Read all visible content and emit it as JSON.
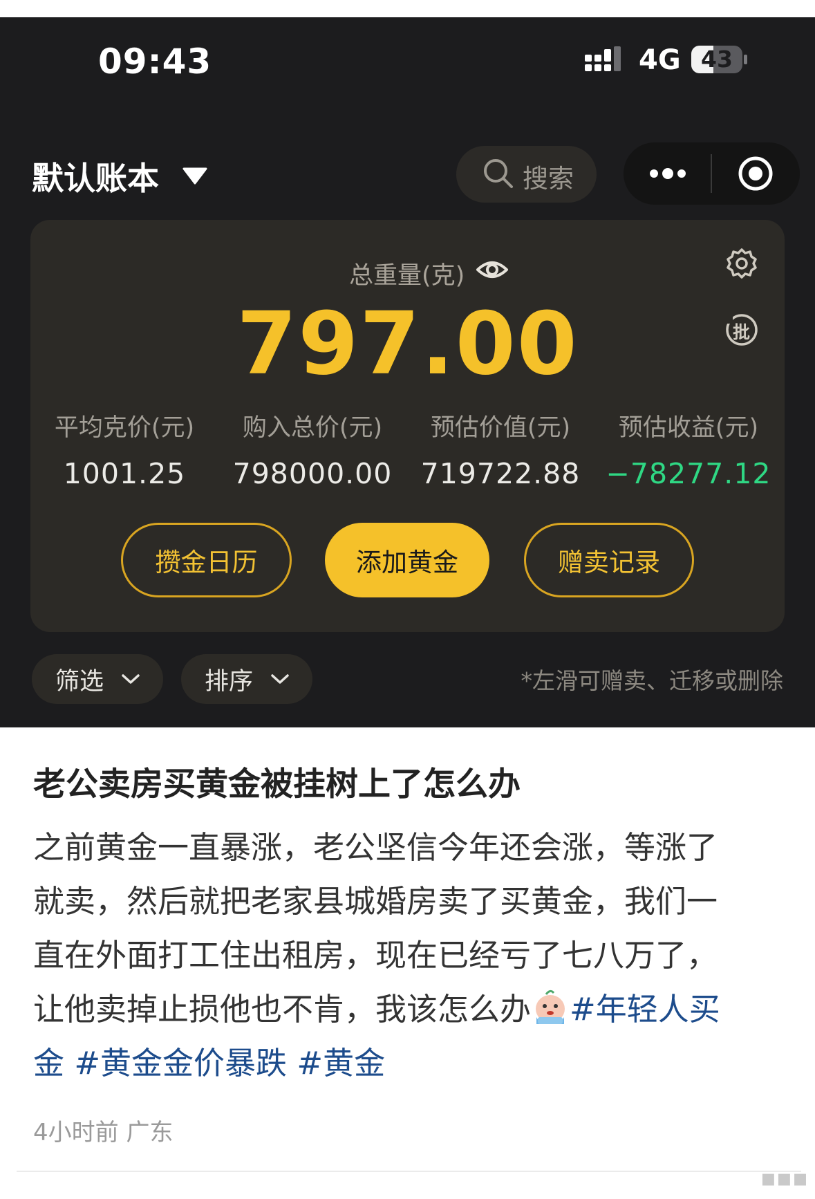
{
  "status_bar": {
    "time": "09:43",
    "network": "4G",
    "battery": "43",
    "battery_level_percent": 43
  },
  "header": {
    "account_book": "默认账本",
    "search_placeholder": "搜索",
    "icons": [
      "caret-down-icon",
      "search-icon",
      "more-icon",
      "target-icon"
    ]
  },
  "summary": {
    "total_weight_label": "总重量(克)",
    "total_weight_value": "797.00",
    "stats": [
      {
        "label": "平均克价(元)",
        "value": "1001.25"
      },
      {
        "label": "购入总价(元)",
        "value": "798000.00"
      },
      {
        "label": "预估价值(元)",
        "value": "719722.88"
      },
      {
        "label": "预估收益(元)",
        "value": "−78277.12"
      }
    ],
    "badge_batch": "批",
    "buttons": {
      "calendar": "攒金日历",
      "add": "添加黄金",
      "records": "赠卖记录"
    },
    "colors": {
      "gold": "#f5c12a",
      "negative": "#2fd884",
      "background": "#1c1c1e",
      "card": "#2c2a26"
    }
  },
  "filters": {
    "filter_label": "筛选",
    "sort_label": "排序",
    "hint": "*左滑可赠卖、迁移或删除"
  },
  "post": {
    "title": "老公卖房买黄金被挂树上了怎么办",
    "lines": [
      "之前黄金一直暴涨，老公坚信今年还会涨，等涨了",
      "就卖，然后就把老家县城婚房卖了买黄金，我们一",
      "直在外面打工住出租房，现在已经亏了七八万了，",
      "让他卖掉止损他也不肯，我该怎么办"
    ],
    "tag_1_part1": "#年轻人买",
    "tag_1_part2": "金",
    "tag_2": "#黄金金价暴跌",
    "tag_3": "#黄金",
    "meta": "4小时前 广东",
    "emoji": "crying-emoji",
    "tag_color": "#1d4c8c"
  }
}
